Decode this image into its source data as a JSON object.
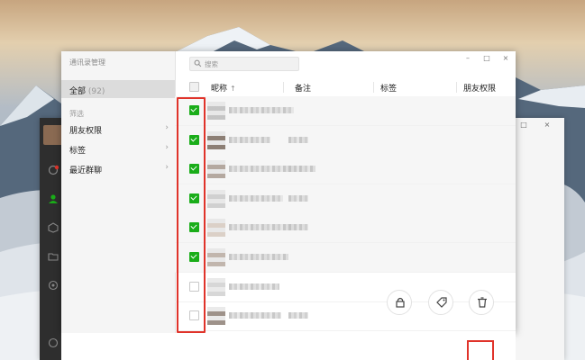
{
  "window": {
    "title": "通讯录管理",
    "controls": {
      "minimize": "–",
      "maximize": "□",
      "close": "×"
    }
  },
  "background_window": {
    "controls": {
      "minimize": "–",
      "maximize": "□",
      "close": "×"
    }
  },
  "sidebar": {
    "all": {
      "label": "全部",
      "count": "(92)"
    },
    "filter_heading": "筛选",
    "items": [
      {
        "label": "朋友权限",
        "chevron": "›"
      },
      {
        "label": "标签",
        "chevron": "›"
      },
      {
        "label": "最近群聊",
        "chevron": "›"
      }
    ]
  },
  "search": {
    "placeholder": "搜索"
  },
  "table": {
    "columns": {
      "nickname": "昵称",
      "sort": "↑",
      "remark": "备注",
      "tags": "标签",
      "permission": "朋友权限"
    },
    "rows": [
      {
        "checked": true,
        "has_remark": false
      },
      {
        "checked": true,
        "has_remark": true
      },
      {
        "checked": true,
        "has_remark": true
      },
      {
        "checked": true,
        "has_remark": true
      },
      {
        "checked": true,
        "has_remark": true
      },
      {
        "checked": true,
        "has_remark": false
      },
      {
        "checked": false,
        "has_remark": false
      },
      {
        "checked": false,
        "has_remark": true
      }
    ]
  },
  "actions": [
    {
      "name": "lock-icon",
      "label": "朋友权限"
    },
    {
      "name": "tag-icon",
      "label": "标签"
    },
    {
      "name": "trash-icon",
      "label": "删除"
    }
  ],
  "colors": {
    "accent": "#1aad19",
    "highlight": "#e0332a",
    "sidebar_dark": "#2e2e2e"
  }
}
